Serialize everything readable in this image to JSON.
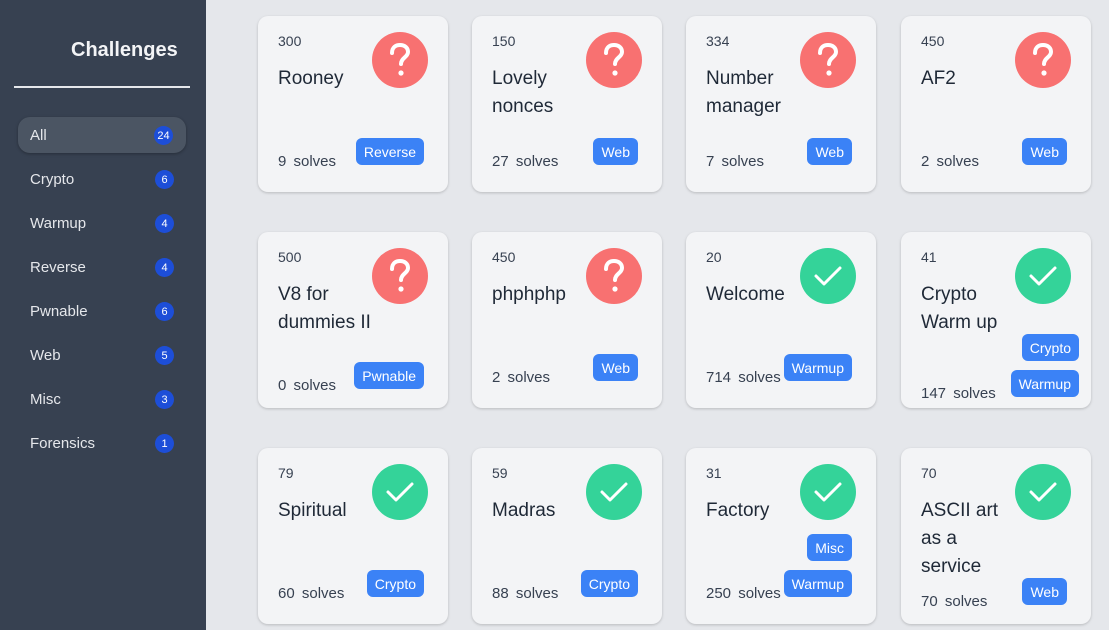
{
  "sidebar": {
    "title": "Challenges",
    "categories": [
      {
        "label": "All",
        "count": "24"
      },
      {
        "label": "Crypto",
        "count": "6"
      },
      {
        "label": "Warmup",
        "count": "4"
      },
      {
        "label": "Reverse",
        "count": "4"
      },
      {
        "label": "Pwnable",
        "count": "6"
      },
      {
        "label": "Web",
        "count": "5"
      },
      {
        "label": "Misc",
        "count": "3"
      },
      {
        "label": "Forensics",
        "count": "1"
      }
    ]
  },
  "challenges": [
    {
      "points": "300",
      "name": "Rooney",
      "status": "unsolved",
      "solves": "9  solves",
      "tags": [
        "Reverse"
      ]
    },
    {
      "points": "150",
      "name": "Lovely nonces",
      "status": "unsolved",
      "solves": "27  solves",
      "tags": [
        "Web"
      ]
    },
    {
      "points": "334",
      "name": "Number manager",
      "status": "unsolved",
      "solves": "7  solves",
      "tags": [
        "Web"
      ]
    },
    {
      "points": "450",
      "name": "AF2",
      "status": "unsolved",
      "solves": "2  solves",
      "tags": [
        "Web"
      ]
    },
    {
      "points": "500",
      "name": "V8 for dummies II",
      "status": "unsolved",
      "solves": "0  solves",
      "tags": [
        "Pwnable"
      ]
    },
    {
      "points": "450",
      "name": "phphphp",
      "status": "unsolved",
      "solves": "2  solves",
      "tags": [
        "Web"
      ]
    },
    {
      "points": "20",
      "name": "Welcome",
      "status": "solved",
      "solves": "714  solves",
      "tags": [
        "Warmup"
      ]
    },
    {
      "points": "41",
      "name": "Crypto Warm up",
      "status": "solved",
      "solves": "147  solves",
      "tags": [
        "Crypto",
        "Warmup"
      ]
    },
    {
      "points": "79",
      "name": "Spiritual",
      "status": "solved",
      "solves": "60  solves",
      "tags": [
        "Crypto"
      ]
    },
    {
      "points": "59",
      "name": "Madras",
      "status": "solved",
      "solves": "88  solves",
      "tags": [
        "Crypto"
      ]
    },
    {
      "points": "31",
      "name": "Factory",
      "status": "solved",
      "solves": "250  solves",
      "tags": [
        "Misc",
        "Warmup"
      ]
    },
    {
      "points": "70",
      "name": "ASCII art as a service",
      "status": "solved",
      "solves": "70  solves",
      "tags": [
        "Web"
      ]
    }
  ],
  "colors": {
    "sidebar_bg": "#374151",
    "unsolved": "#f87171",
    "solved": "#34d399",
    "tag": "#3b82f6",
    "count_badge": "#1d4ed8"
  },
  "icons": {
    "unsolved": "question-mark-icon",
    "solved": "checkmark-icon"
  }
}
